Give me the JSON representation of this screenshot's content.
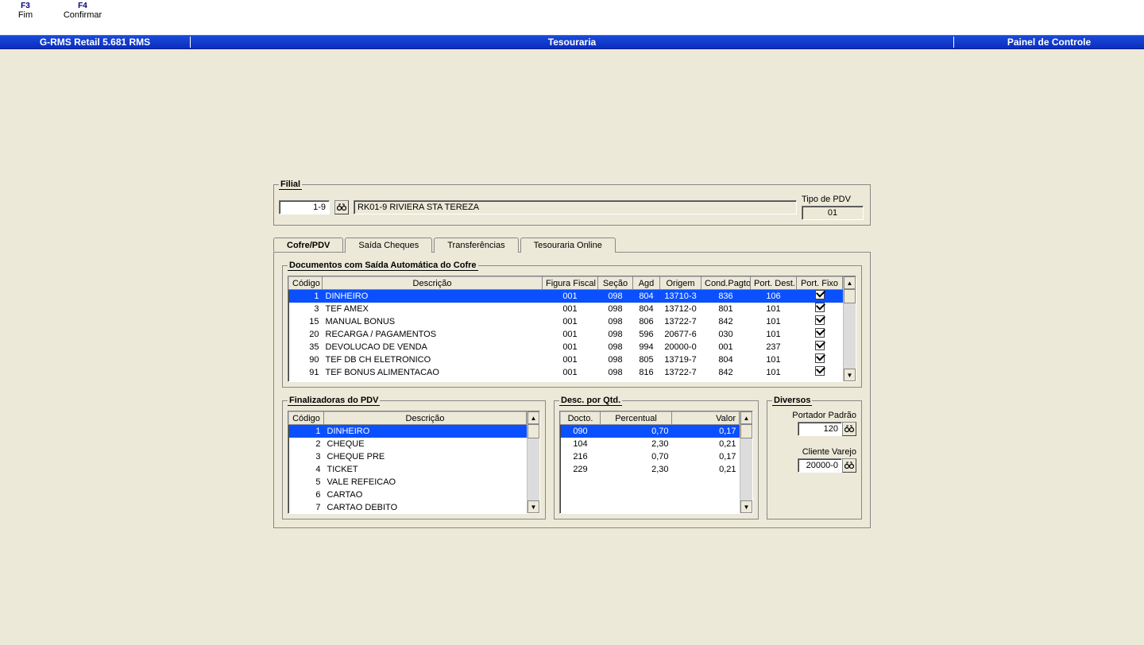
{
  "toolbar": {
    "f3_key": "F3",
    "f3_label": "Fim",
    "f4_key": "F4",
    "f4_label": "Confirmar"
  },
  "titlebar": {
    "left": "G-RMS Retail 5.681 RMS",
    "center": "Tesouraria",
    "right": "Painel de Controle"
  },
  "filial": {
    "legend": "Filial",
    "code": "1-9",
    "name": "RK01-9 RIVIERA STA TEREZA",
    "tipo_label": "Tipo de PDV",
    "tipo_value": "01"
  },
  "tabs": {
    "t0": "Cofre/PDV",
    "t1": "Saída Cheques",
    "t2": "Transferências",
    "t3": "Tesouraria Online"
  },
  "docs": {
    "legend": "Documentos com Saída Automática do Cofre",
    "headers": {
      "codigo": "Código",
      "desc": "Descrição",
      "figura": "Figura Fiscal",
      "secao": "Seção",
      "agd": "Agd",
      "origem": "Origem",
      "cond": "Cond.Pagto",
      "portdest": "Port. Dest.",
      "portfixo": "Port. Fixo"
    },
    "rows": [
      {
        "codigo": "1",
        "desc": "DINHEIRO",
        "figura": "001",
        "secao": "098",
        "agd": "804",
        "origem": "13710-3",
        "cond": "836",
        "portdest": "106",
        "fixo": true,
        "sel": true
      },
      {
        "codigo": "3",
        "desc": "TEF AMEX",
        "figura": "001",
        "secao": "098",
        "agd": "804",
        "origem": "13712-0",
        "cond": "801",
        "portdest": "101",
        "fixo": true,
        "sel": false
      },
      {
        "codigo": "15",
        "desc": "MANUAL BONUS",
        "figura": "001",
        "secao": "098",
        "agd": "806",
        "origem": "13722-7",
        "cond": "842",
        "portdest": "101",
        "fixo": true,
        "sel": false
      },
      {
        "codigo": "20",
        "desc": "RECARGA / PAGAMENTOS",
        "figura": "001",
        "secao": "098",
        "agd": "596",
        "origem": "20677-6",
        "cond": "030",
        "portdest": "101",
        "fixo": true,
        "sel": false
      },
      {
        "codigo": "35",
        "desc": "DEVOLUCAO DE VENDA",
        "figura": "001",
        "secao": "098",
        "agd": "994",
        "origem": "20000-0",
        "cond": "001",
        "portdest": "237",
        "fixo": true,
        "sel": false
      },
      {
        "codigo": "90",
        "desc": "TEF DB CH ELETRONICO",
        "figura": "001",
        "secao": "098",
        "agd": "805",
        "origem": "13719-7",
        "cond": "804",
        "portdest": "101",
        "fixo": true,
        "sel": false
      },
      {
        "codigo": "91",
        "desc": "TEF BONUS ALIMENTACAO",
        "figura": "001",
        "secao": "098",
        "agd": "816",
        "origem": "13722-7",
        "cond": "842",
        "portdest": "101",
        "fixo": true,
        "sel": false
      }
    ]
  },
  "final": {
    "legend": "Finalizadoras do PDV",
    "headers": {
      "codigo": "Código",
      "desc": "Descrição"
    },
    "rows": [
      {
        "codigo": "1",
        "desc": "DINHEIRO",
        "sel": true
      },
      {
        "codigo": "2",
        "desc": "CHEQUE",
        "sel": false
      },
      {
        "codigo": "3",
        "desc": "CHEQUE PRE",
        "sel": false
      },
      {
        "codigo": "4",
        "desc": "TICKET",
        "sel": false
      },
      {
        "codigo": "5",
        "desc": "VALE REFEICAO",
        "sel": false
      },
      {
        "codigo": "6",
        "desc": "CARTAO",
        "sel": false
      },
      {
        "codigo": "7",
        "desc": "CARTAO DEBITO",
        "sel": false
      }
    ]
  },
  "desc": {
    "legend": "Desc. por Qtd.",
    "headers": {
      "docto": "Docto.",
      "perc": "Percentual",
      "valor": "Valor"
    },
    "rows": [
      {
        "docto": "090",
        "perc": "0,70",
        "valor": "0,17",
        "sel": true
      },
      {
        "docto": "104",
        "perc": "2,30",
        "valor": "0,21",
        "sel": false
      },
      {
        "docto": "216",
        "perc": "0,70",
        "valor": "0,17",
        "sel": false
      },
      {
        "docto": "229",
        "perc": "2,30",
        "valor": "0,21",
        "sel": false
      }
    ]
  },
  "diversos": {
    "legend": "Diversos",
    "portador_label": "Portador Padrão",
    "portador_value": "120",
    "cliente_label": "Cliente Varejo",
    "cliente_value": "20000-0"
  }
}
